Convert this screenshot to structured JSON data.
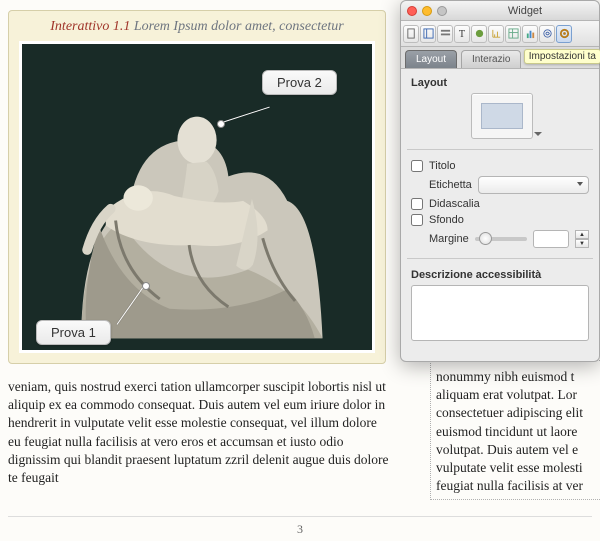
{
  "widget_frame": {
    "label_prefix": "Interattivo 1.1",
    "label_rest": " Lorem Ipsum dolor amet, consectetur",
    "callouts": [
      {
        "label": "Prova 2"
      },
      {
        "label": "Prova 1"
      }
    ]
  },
  "body_col1": "veniam, quis nostrud exerci tation ullamcorper suscipit lobortis nisl ut aliquip ex ea commodo consequat.  Duis autem vel eum iriure dolor in hendrerit in vulputate velit esse molestie consequat, vel illum dolore eu feugiat nulla facilisis at vero eros et accumsan et iusto odio dignissim qui blandit praesent luptatum zzril delenit augue duis dolore te feugait",
  "body_col2": "nonummy nibh euismod t aliquam erat volutpat. Lor consectetuer adipiscing elit euismod tincidunt ut laore volutpat. Duis autem vel e vulputate velit esse molesti feugiat nulla facilisis at ver",
  "page_number": "3",
  "inspector": {
    "title": "Widget",
    "tabs": {
      "layout": "Layout",
      "interaction": "Interazio"
    },
    "tooltip": "Impostazioni ta",
    "section_layout": "Layout",
    "cb_titolo": "Titolo",
    "lbl_etichetta": "Etichetta",
    "cb_didascalia": "Didascalia",
    "cb_sfondo": "Sfondo",
    "lbl_margine": "Margine",
    "section_access": "Descrizione accessibilità"
  }
}
